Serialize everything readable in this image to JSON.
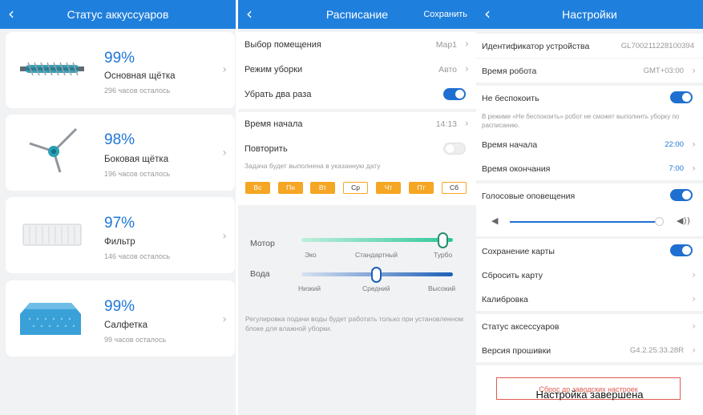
{
  "accessories": {
    "title": "Статус аккуссуаров",
    "items": [
      {
        "percent": "99%",
        "name": "Основная щётка",
        "remaining": "296 часов осталось",
        "icon": "main-brush"
      },
      {
        "percent": "98%",
        "name": "Боковая щётка",
        "remaining": "196 часов осталось",
        "icon": "side-brush"
      },
      {
        "percent": "97%",
        "name": "Фильтр",
        "remaining": "146 часов осталось",
        "icon": "filter"
      },
      {
        "percent": "99%",
        "name": "Салфетка",
        "remaining": "99 часов осталось",
        "icon": "mop-cloth"
      }
    ]
  },
  "schedule": {
    "title": "Расписание",
    "save": "Сохранить",
    "room_label": "Выбор помещения",
    "room_value": "Map1",
    "mode_label": "Режим уборки",
    "mode_value": "Авто",
    "twice_label": "Убрать два раза",
    "twice_on": true,
    "start_label": "Время начала",
    "start_value": "14:13",
    "repeat_label": "Повторить",
    "repeat_on": false,
    "repeat_note": "Задача будет выполнена в указанную дату",
    "days": [
      {
        "label": "Вс",
        "selected": true
      },
      {
        "label": "Пн",
        "selected": true
      },
      {
        "label": "Вт",
        "selected": true
      },
      {
        "label": "Ср",
        "selected": false
      },
      {
        "label": "Чт",
        "selected": true
      },
      {
        "label": "Пт",
        "selected": true
      },
      {
        "label": "Сб",
        "selected": false
      }
    ],
    "motor_label": "Мотор",
    "motor_ticks": [
      "Эко",
      "Стандартный",
      "Турбо"
    ],
    "motor_selected": "Турбо",
    "water_label": "Вода",
    "water_ticks": [
      "Низкий",
      "Средний",
      "Высокий"
    ],
    "water_selected": "Средний",
    "water_note": "Регулировка подачи воды будет работать только при установленном блоке для влажной уборки."
  },
  "settings": {
    "title": "Настройки",
    "device_id_label": "Идентификатор устройства",
    "device_id_value": "GL700211228100394",
    "robot_time_label": "Время робота",
    "robot_time_value": "GMT+03:00",
    "dnd_label": "Не беспокоить",
    "dnd_on": true,
    "dnd_note": "В режиме «Не беспокоить» робот не сможет выполнить уборку по расписанию.",
    "dnd_start_label": "Время начала",
    "dnd_start_value": "22:00",
    "dnd_end_label": "Время окончания",
    "dnd_end_value": "7:00",
    "voice_label": "Голосовые оповещения",
    "voice_on": true,
    "volume_level": 0.97,
    "map_save_label": "Сохранение карты",
    "map_save_on": true,
    "map_reset_label": "Сбросить карту",
    "calibration_label": "Калибровка",
    "accessory_status_label": "Статус аксессуаров",
    "firmware_label": "Версия прошивки",
    "firmware_value": "G4.2.25.33.28R",
    "factory_reset_label": "Сброс до заводских настроек",
    "overlay_text": "Настройка завершена"
  },
  "colors": {
    "header": "#1f7fdc",
    "accent": "#1f77d6",
    "day_selected": "#f5a623",
    "danger": "#e05a4f"
  }
}
